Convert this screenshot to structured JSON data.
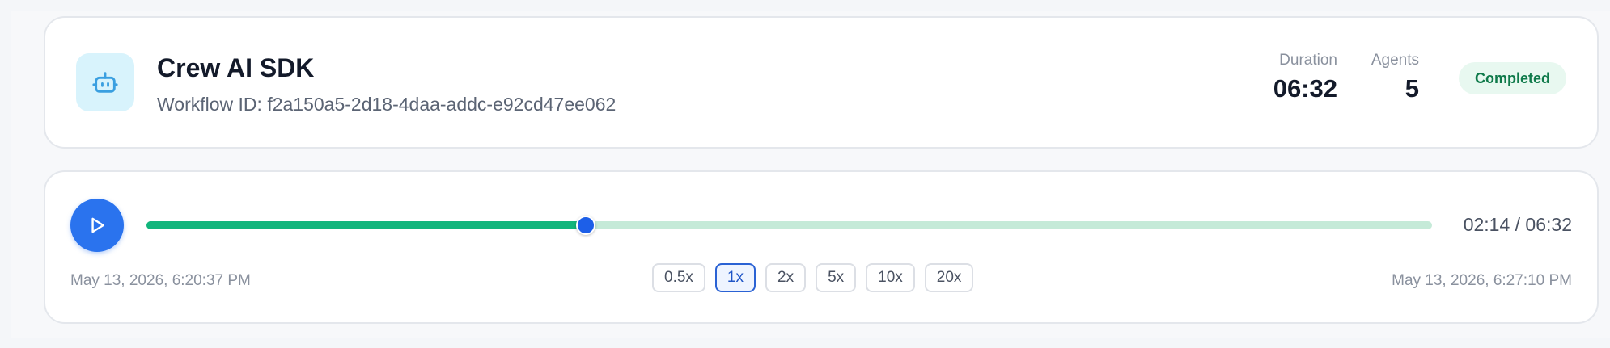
{
  "workflow": {
    "title": "Crew AI SDK",
    "id_label": "Workflow ID: f2a150a5-2d18-4daa-addc-e92cd47ee062",
    "icon": "robot-icon"
  },
  "stats": {
    "duration_label": "Duration",
    "duration_value": "06:32",
    "agents_label": "Agents",
    "agents_value": "5"
  },
  "status": {
    "label": "Completed",
    "color": "#0f7a4a",
    "background": "#e8f8f0"
  },
  "player": {
    "play_icon": "play-icon",
    "progress": 0.3418,
    "time_readout": "02:14 / 06:32",
    "start_time": "May 13, 2026, 6:20:37 PM",
    "end_time": "May 13, 2026, 6:27:10 PM",
    "speeds": [
      {
        "label": "0.5x",
        "active": false
      },
      {
        "label": "1x",
        "active": true
      },
      {
        "label": "2x",
        "active": false
      },
      {
        "label": "5x",
        "active": false
      },
      {
        "label": "10x",
        "active": false
      },
      {
        "label": "20x",
        "active": false
      }
    ]
  },
  "colors": {
    "accent": "#2a73ee",
    "progress_fill": "#12b57c",
    "progress_track": "#c5ead8",
    "thumb": "#1d5fe8"
  }
}
